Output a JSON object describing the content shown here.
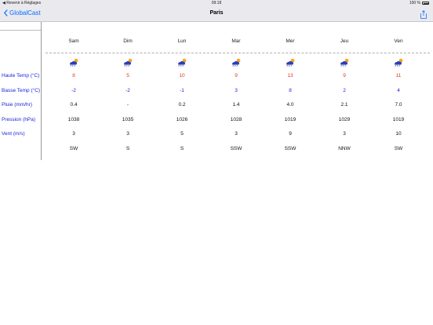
{
  "status_bar": {
    "back_label": "◀ Revenir à Réglages",
    "time": "09:18",
    "battery": "100 %"
  },
  "nav": {
    "back_label": "GlobalCast",
    "title": "Paris"
  },
  "days": [
    "Sam",
    "Dim",
    "Lun",
    "Mar",
    "Mer",
    "Jeu",
    "Ven"
  ],
  "weather_icon": "partly-cloudy-rain-icon",
  "rows": [
    {
      "label": "Haute Temp (°C)",
      "values": [
        "8",
        "5",
        "10",
        "9",
        "13",
        "9",
        "11"
      ]
    },
    {
      "label": "Basse Temp (°C)",
      "values": [
        "-2",
        "-2",
        "-1",
        "3",
        "8",
        "2",
        "4"
      ]
    },
    {
      "label": "Pluie (mm/hr)",
      "values": [
        "0.4",
        "-",
        "0.2",
        "1.4",
        "4.0",
        "2.1",
        "7.0"
      ]
    },
    {
      "label": "Pression (hPa)",
      "values": [
        "1038",
        "1035",
        "1026",
        "1028",
        "1019",
        "1029",
        "1019"
      ]
    },
    {
      "label": "Vent (m/s)",
      "values": [
        "3",
        "3",
        "5",
        "3",
        "9",
        "3",
        "10"
      ]
    },
    {
      "label": "",
      "values": [
        "SW",
        "S",
        "S",
        "SSW",
        "SSW",
        "NNW",
        "SW"
      ]
    }
  ],
  "colors": {
    "accent": "#0a6cff",
    "high_temp": "#e8322a",
    "low_temp": "#1a23d8",
    "label": "#1a23d8"
  }
}
